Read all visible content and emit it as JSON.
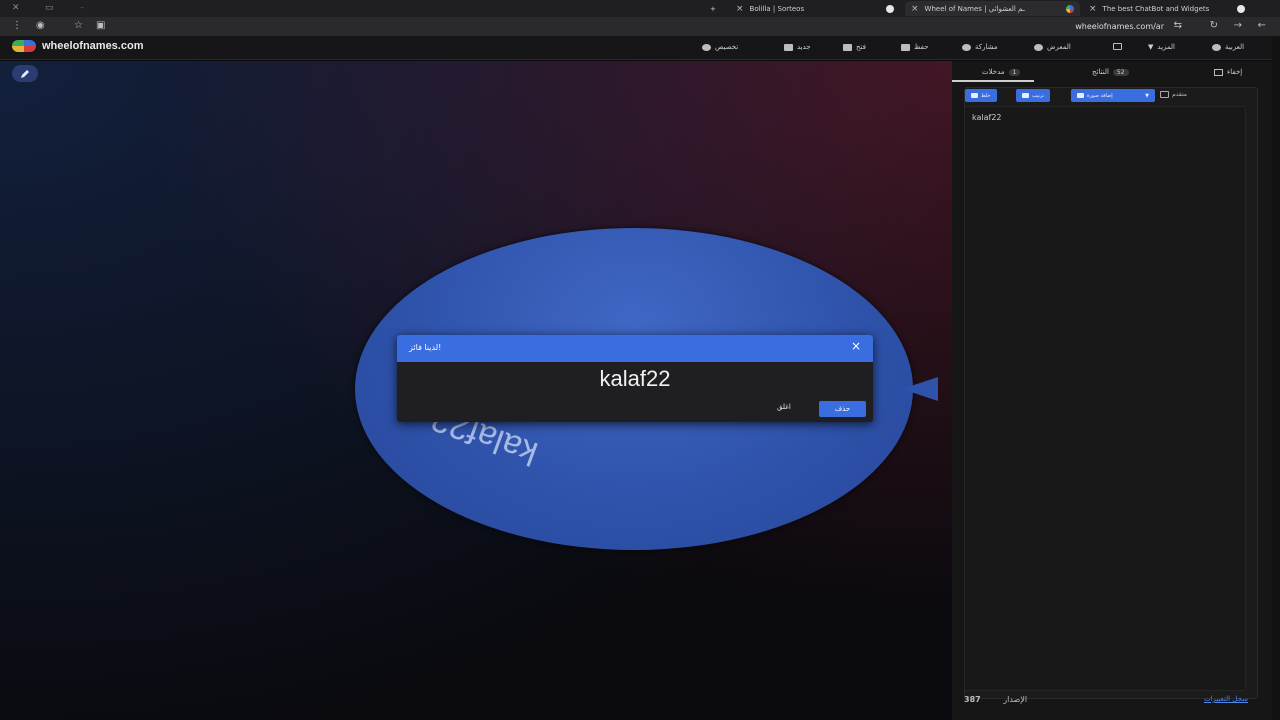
{
  "browser": {
    "tabs": [
      {
        "title": "Bolilla | Sorteos",
        "active": false
      },
      {
        "title": "Wheel of Names | ـم العشوائي",
        "active": true
      },
      {
        "title": "The best ChatBot and Widgets",
        "active": false
      }
    ],
    "new_tab": "+",
    "url": "wheelofnames.com/ar"
  },
  "site": {
    "logo_text": "wheelofnames.com",
    "menu": {
      "customize": "تخصيص",
      "new": "جديد",
      "open": "فتح",
      "save": "حفظ",
      "share": "مشاركة",
      "gallery": "المعرض",
      "more": "المزيد",
      "language": "العربية"
    }
  },
  "wheel": {
    "segment_label": "kalaf22",
    "color": "#2f53ab"
  },
  "dialog": {
    "title": "لدينا فائز!",
    "winner": "kalaf22",
    "close_label": "اغلق",
    "remove_label": "حذف"
  },
  "panel": {
    "hide_label": "إخفاء",
    "tab_entries": "مدخلات",
    "tab_entries_count": "1",
    "tab_results": "النتائج",
    "tab_results_count": "52",
    "toolbar": {
      "shuffle": "خلط",
      "sort": "ترتيب",
      "add_image": "إضافة صورة",
      "advanced": "متقدم"
    },
    "entries_text": "kalaf22",
    "version_label": "الإصدار",
    "version_number": "387",
    "changelog": "سجل التغييرات"
  },
  "colors": {
    "accent": "#3a6ee0",
    "panel_bg": "#161616"
  }
}
